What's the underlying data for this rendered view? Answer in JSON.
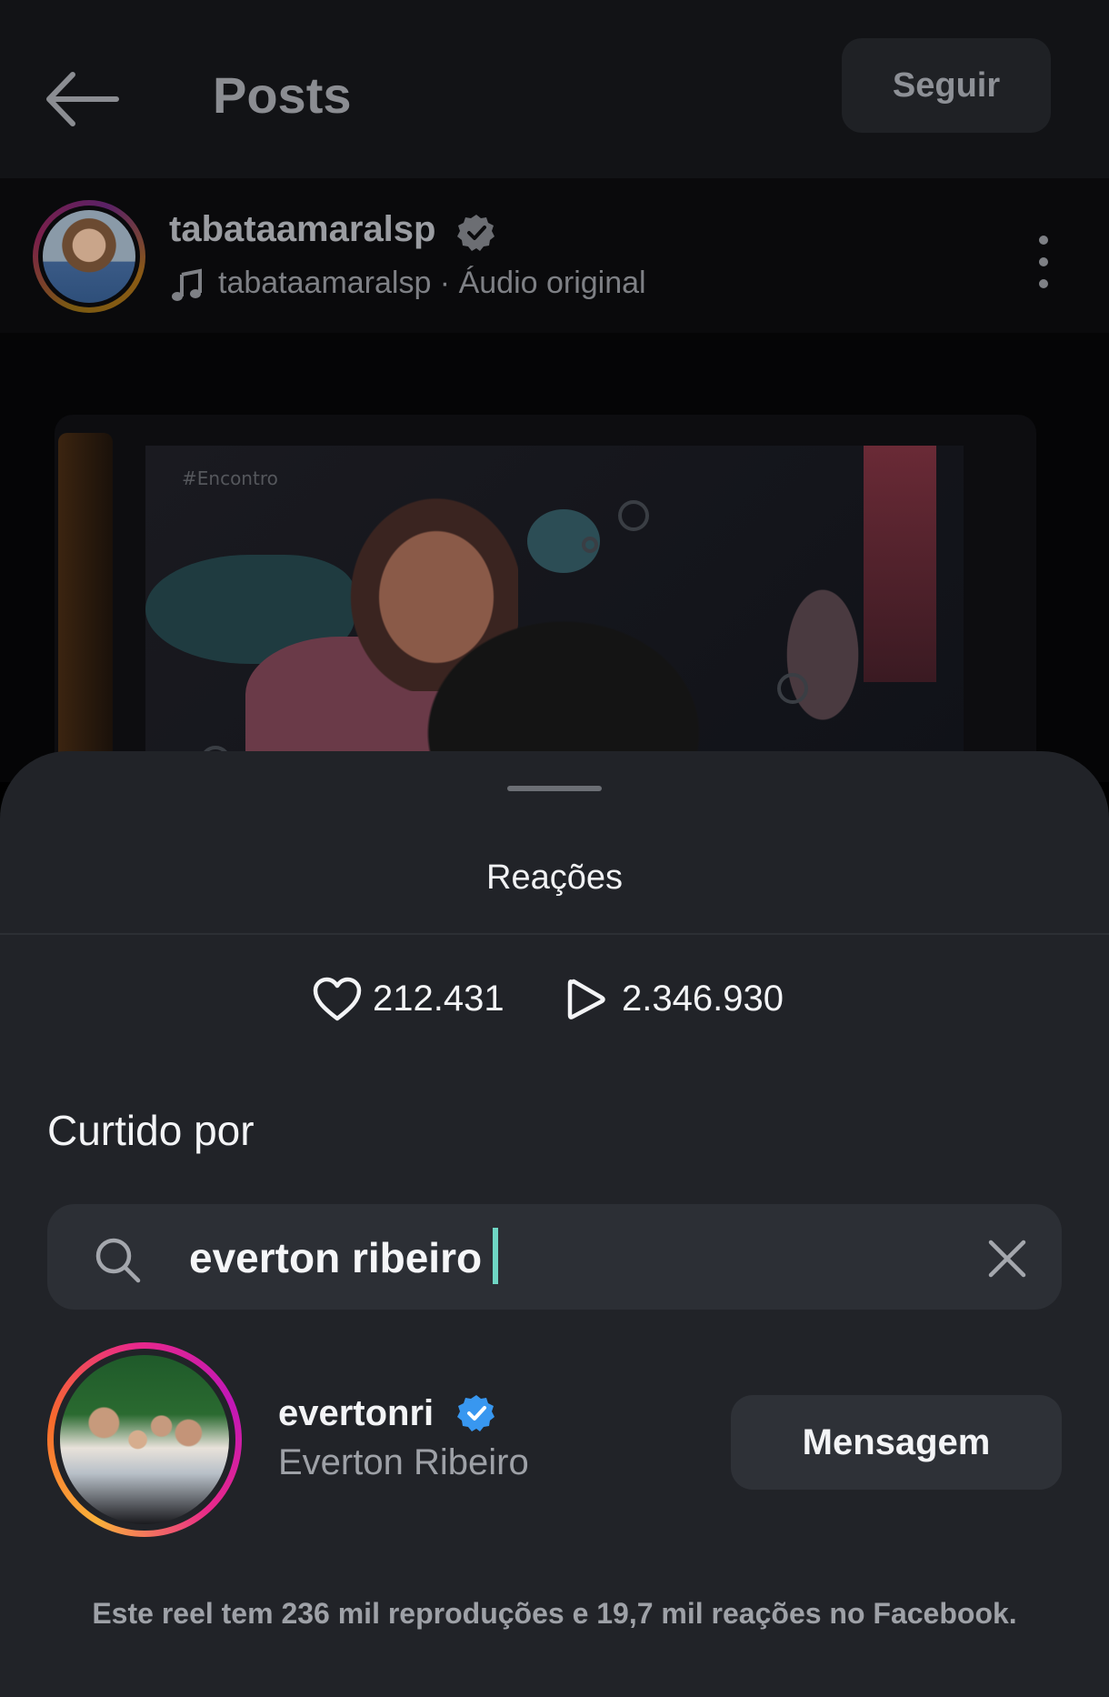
{
  "header": {
    "title": "Posts",
    "follow_label": "Seguir"
  },
  "post": {
    "username": "tabataamaralsp",
    "audio": "tabataamaralsp · Áudio original",
    "video_tag": "#Encontro"
  },
  "sheet": {
    "title": "Reações",
    "likes": "212.431",
    "plays": "2.346.930",
    "liked_by_heading": "Curtido por",
    "search": {
      "value": "everton ribeiro",
      "placeholder": ""
    },
    "result": {
      "username": "evertonri",
      "full_name": "Everton Ribeiro",
      "message_label": "Mensagem"
    },
    "footer_note": "Este reel tem 236 mil reproduções e 19,7 mil reações no Facebook."
  },
  "colors": {
    "sheet_bg": "#212328",
    "verified_blue": "#3897f0",
    "caret": "#6fd6c4"
  },
  "icons": [
    "back-arrow-icon",
    "verified-icon",
    "music-note-icon",
    "more-vertical-icon",
    "heart-icon",
    "play-icon",
    "search-icon",
    "close-icon"
  ]
}
